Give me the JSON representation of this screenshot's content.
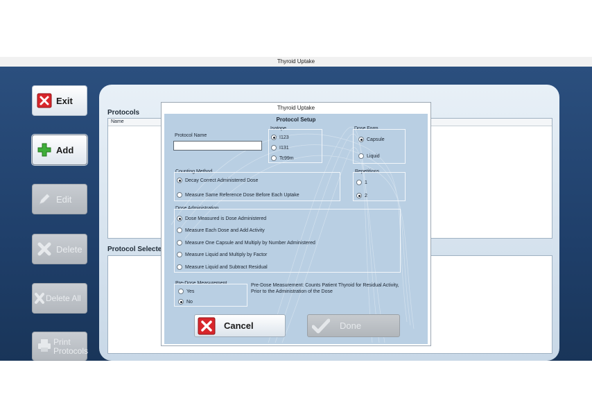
{
  "window": {
    "title": "Thyroid Uptake"
  },
  "sidebar": {
    "exit_label": "Exit",
    "add_label": "Add",
    "edit_label": "Edit",
    "delete_label": "Delete",
    "delete_all_label": "Delete All",
    "print_label_1": "Print",
    "print_label_2": "Protocols"
  },
  "main": {
    "protocols_label": "Protocols",
    "name_column": "Name",
    "protocol_selected_label": "Protocol Selected"
  },
  "dialog": {
    "title": "Thyroid Uptake",
    "heading": "Protocol Setup",
    "protocol_name_label": "Protocol Name",
    "protocol_name_value": "",
    "isotope": {
      "label": "Isotope",
      "options": [
        "I123",
        "I131",
        "Tc99m"
      ],
      "selected": "I123"
    },
    "dose_form": {
      "label": "Dose Form",
      "options": [
        "Capsule",
        "Liquid"
      ],
      "selected": "Capsule"
    },
    "counting_method": {
      "label": "Counting Method",
      "options": [
        "Decay Correct Administered Dose",
        "Measure Same Reference Dose Before Each Uptake"
      ],
      "selected": "Decay Correct Administered Dose"
    },
    "repetitions": {
      "label": "Repetitions",
      "options": [
        "1",
        "2"
      ],
      "selected": "2"
    },
    "dose_administration": {
      "label": "Dose Administration",
      "options": [
        "Dose Measured is Dose Administered",
        "Measure Each Dose and Add Activity",
        "Measure One Capsule and Multiply by Number Administered",
        "Measure Liquid and Multiply by Factor",
        "Measure Liquid and Subtract Residual"
      ],
      "selected": "Dose Measured is Dose Administered"
    },
    "pre_dose": {
      "label": "Pre-Dose Measurement",
      "options": [
        "Yes",
        "No"
      ],
      "selected": "No"
    },
    "pre_dose_note_1": "Pre-Dose Measurement: Counts Patient Thyroid for Residual Activity,",
    "pre_dose_note_2": "Prior to the Administration of the Dose",
    "cancel_label": "Cancel",
    "done_label": "Done"
  },
  "colors": {
    "desktop": "#1f3f6a",
    "dialog_body": "#b9cfe3",
    "exit_red": "#d8262b",
    "add_green": "#3fae3a"
  }
}
